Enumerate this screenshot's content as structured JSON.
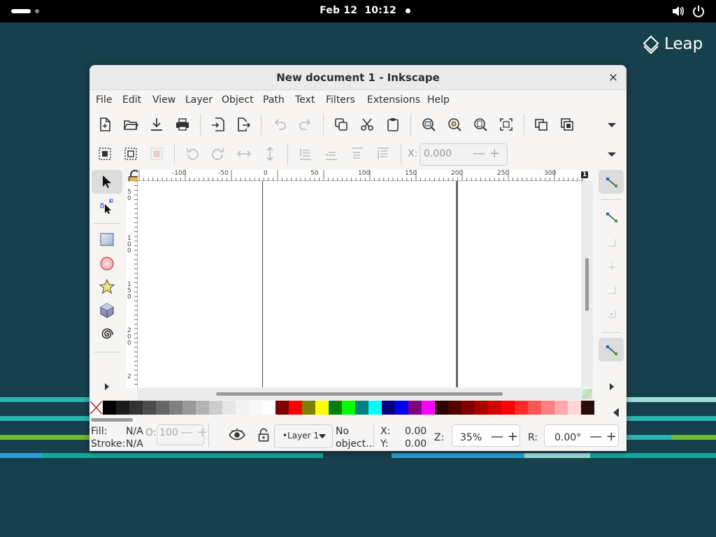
{
  "topbar": {
    "date": "Feb 12",
    "time": "10:12"
  },
  "desktop": {
    "logo_text": "Leap"
  },
  "window": {
    "title": "New document 1 - Inkscape",
    "close_glyph": "×"
  },
  "menu": [
    "File",
    "Edit",
    "View",
    "Layer",
    "Object",
    "Path",
    "Text",
    "Filters",
    "Extensions",
    "Help"
  ],
  "toolbar": {
    "x_label": "X:",
    "x_value": "0.000"
  },
  "ruler": {
    "h_labels": [
      "-100",
      "-50",
      "0",
      "50",
      "100",
      "150",
      "200",
      "250",
      "300"
    ],
    "v_labels": [
      "5 0",
      "1 0 0",
      "1 5 0",
      "2 0 0",
      "2"
    ],
    "page_badge": "1"
  },
  "palette": {
    "colors": [
      "#000000",
      "#1a1a1a",
      "#333333",
      "#4d4d4d",
      "#666666",
      "#808080",
      "#999999",
      "#b3b3b3",
      "#cccccc",
      "#e6e6e6",
      "#f2f2f2",
      "#f8f8f8",
      "#ffffff",
      "#800000",
      "#ff0000",
      "#808000",
      "#ffff00",
      "#008000",
      "#00ff00",
      "#008080",
      "#00ffff",
      "#000080",
      "#0000ff",
      "#800080",
      "#ff00ff",
      "#2b0000",
      "#550000",
      "#800000",
      "#aa0000",
      "#d40000",
      "#ff0000",
      "#ff2a2a",
      "#ff5555",
      "#ff8080",
      "#ffaaaa",
      "#ffd5d5",
      "#280b0b"
    ]
  },
  "status": {
    "fill_label": "Fill:",
    "fill_value": "N/A",
    "stroke_label": "Stroke:",
    "stroke_value": "N/A",
    "opacity_label": "O:",
    "opacity_value": "100",
    "layer_name": "•Layer 1",
    "selection_line1": "No",
    "selection_line2": "object...",
    "x_label": "X:",
    "x_value": "0.00",
    "y_label": "Y:",
    "y_value": "0.00",
    "zoom_label": "Z:",
    "zoom_value": "35%",
    "rotation_label": "R:",
    "rotation_value": "0.00°"
  }
}
